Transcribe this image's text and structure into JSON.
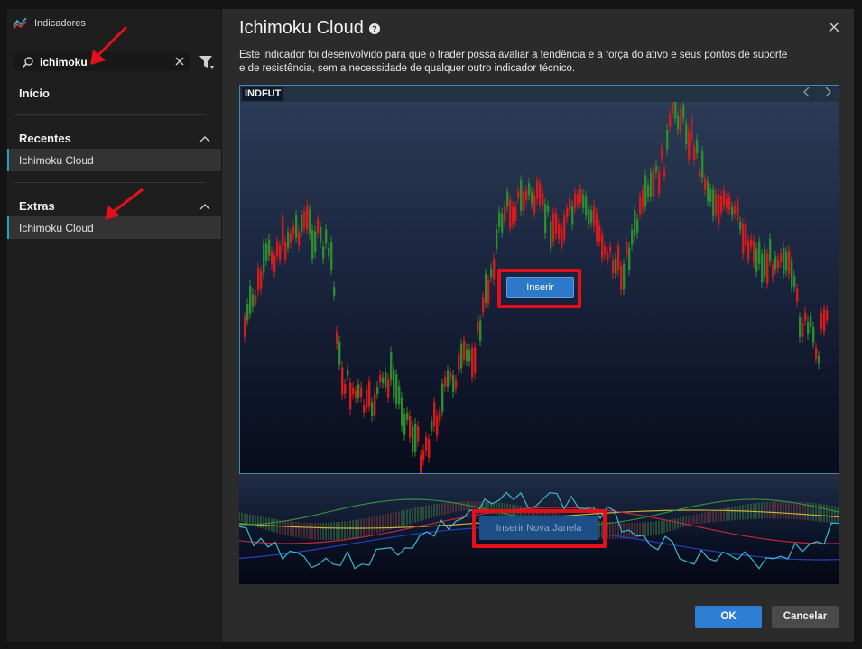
{
  "sidebar": {
    "app_title": "Indicadores",
    "search": {
      "value": "ichimoku",
      "placeholder": ""
    },
    "home_label": "Início",
    "sections": [
      {
        "title": "Recentes",
        "items": [
          "Ichimoku Cloud"
        ]
      },
      {
        "title": "Extras",
        "items": [
          "Ichimoku Cloud"
        ]
      }
    ]
  },
  "main": {
    "title": "Ichimoku Cloud",
    "description": "Este indicador foi desenvolvido para que o trader possa avaliar a tendência e a força do ativo e seus pontos de suporte e de resistência, sem a necessidade de qualquer outro indicador técnico.",
    "chart": {
      "ticker": "INDFUT"
    },
    "insert_label": "Inserir",
    "insert_new_window_label": "Inserir Nova Janela",
    "ok_label": "OK",
    "cancel_label": "Cancelar"
  },
  "colors": {
    "accent": "#2e7fd3",
    "highlight_red": "#e3101a",
    "candle_up": "#2e8b2e",
    "candle_down": "#d61b1b",
    "selection_bar": "#1aa6c7"
  }
}
